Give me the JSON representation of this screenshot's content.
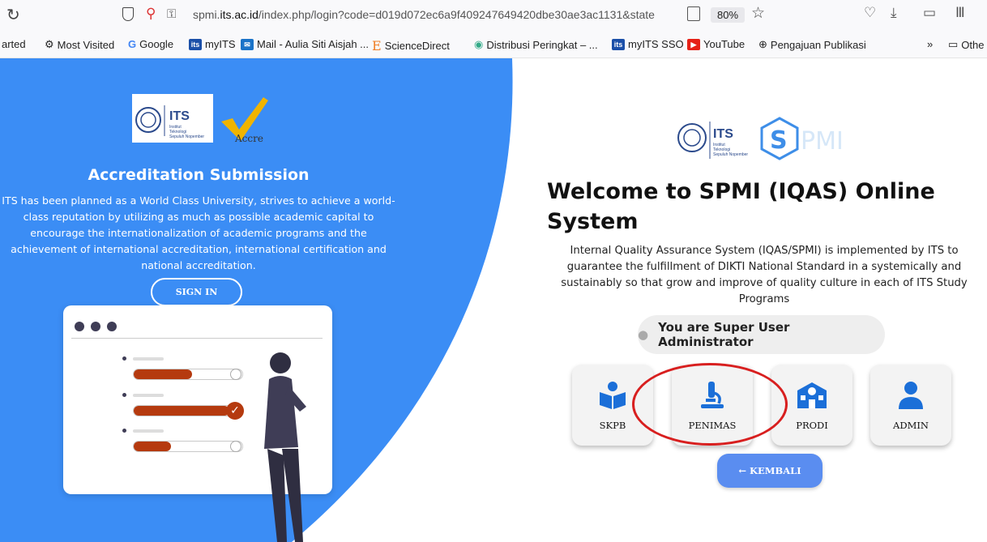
{
  "browser": {
    "url_prefix": "spmi.",
    "url_domain": "its.ac.id",
    "url_rest": "/index.php/login?code=d019d072ec6a9f409247649420dbe30ae3ac1131&state",
    "zoom": "80%",
    "bookmarks": [
      {
        "label": "arted"
      },
      {
        "label": "Most Visited"
      },
      {
        "label": "Google"
      },
      {
        "label": "myITS"
      },
      {
        "label": "Mail - Aulia Siti Aisjah ..."
      },
      {
        "label": "ScienceDirect"
      },
      {
        "label": "Distribusi Peringkat – ..."
      },
      {
        "label": "myITS SSO"
      },
      {
        "label": "YouTube"
      },
      {
        "label": "Pengajuan Publikasi"
      },
      {
        "label": "Othe"
      }
    ]
  },
  "left": {
    "its_logo": "ITS",
    "its_sub": "Institut\nTeknologi\nSepuluh Nopember",
    "accre_text": "Accre",
    "title": "Accreditation Submission",
    "description": "ITS has been planned as a World Class University, strives to achieve a world-class reputation by utilizing as much as possible academic capital to encourage the internationalization of academic programs and the achievement of international accreditation, international certification and national accreditation.",
    "signin_label": "SIGN IN"
  },
  "right": {
    "its_logo": "ITS",
    "spmi_text": "PMI",
    "welcome": "Welcome to SPMI (IQAS) Online System",
    "intro": "Internal Quality Assurance System (IQAS/SPMI) is implemented by ITS to guarantee the fulfillment of DIKTI National Standard in a systemically and sustainably so that grow and improve of quality culture in each of ITS Study Programs",
    "user_role": "You are Super User Administrator",
    "tiles": [
      {
        "label": "SKPB",
        "icon": "book-reader-icon"
      },
      {
        "label": "PENIMAS",
        "icon": "microscope-icon"
      },
      {
        "label": "PRODI",
        "icon": "school-icon"
      },
      {
        "label": "ADMIN",
        "icon": "user-icon"
      }
    ],
    "back_label": "← KEMBALI"
  },
  "colors": {
    "panel_blue": "#3b8df5",
    "tile_icon": "#1b6fd8",
    "button_blue": "#5a8df0",
    "bar_fill": "#b53a0f",
    "highlight": "#d81f1f"
  },
  "illustration": {
    "progress": [
      0.54,
      0.88,
      0.34
    ]
  }
}
